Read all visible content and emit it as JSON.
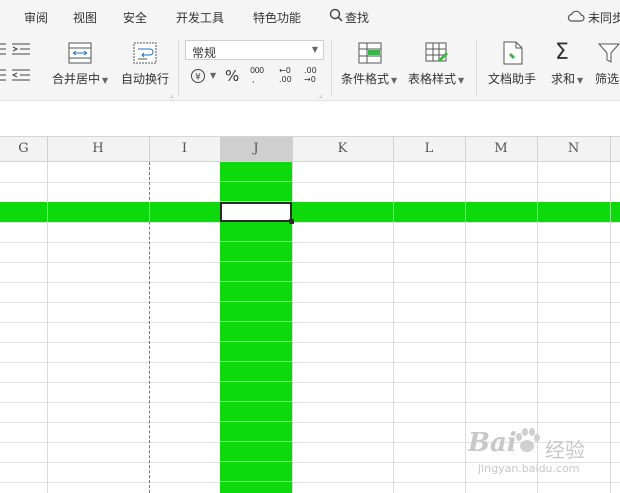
{
  "menu": {
    "items": [
      "审阅",
      "视图",
      "安全",
      "开发工具",
      "特色功能"
    ],
    "search_label": "查找",
    "sync_label": "未同步"
  },
  "ribbon": {
    "merge_center": "合并居中",
    "auto_wrap": "自动换行",
    "number_format": "常规",
    "percent": "%",
    "thousands": "000",
    "inc_decimal_top": "←0",
    "inc_decimal_bottom": ".00",
    "dec_decimal_top": ".00",
    "dec_decimal_bottom": "→0",
    "conditional_format": "条件格式",
    "table_style": "表格样式",
    "doc_assistant": "文档助手",
    "sum": "求和",
    "filter": "筛选"
  },
  "grid": {
    "columns": [
      "G",
      "H",
      "I",
      "J",
      "K",
      "L",
      "M",
      "N"
    ],
    "highlight_color": "#0dd90d"
  },
  "watermark": {
    "brand": "Bai",
    "brand2": "经验",
    "url": "jingyan.baidu.com"
  }
}
